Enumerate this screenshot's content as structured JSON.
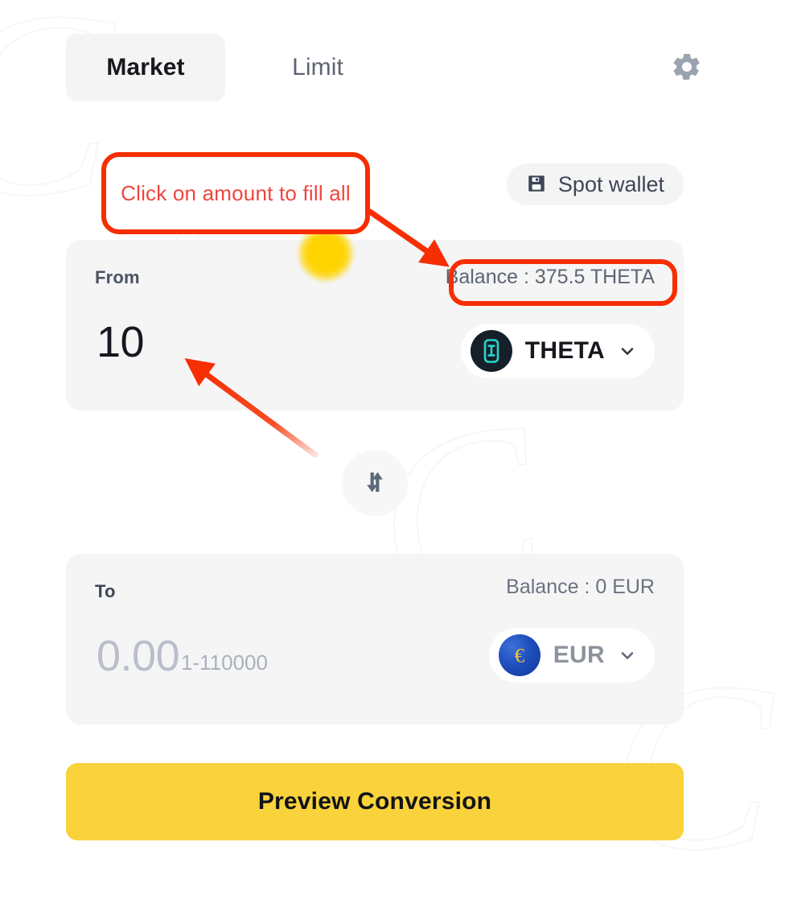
{
  "tabs": [
    {
      "label": "Market",
      "active": true
    },
    {
      "label": "Limit",
      "active": false
    }
  ],
  "header": {
    "settings_icon": "gear-icon"
  },
  "wallet_selector": {
    "label": "Spot wallet",
    "icon": "wallet-icon"
  },
  "from": {
    "label": "From",
    "balance": "Balance : 375.5 THETA",
    "amount": "10",
    "asset": "THETA",
    "asset_icon": "theta-token-icon",
    "chevron": "chevron-down-icon"
  },
  "swap": {
    "icon": "swap-vertical-arrows-icon"
  },
  "to": {
    "label": "To",
    "balance": "Balance : 0 EUR",
    "amount": "0.00",
    "hint": "1-110000",
    "asset": "EUR",
    "asset_icon": "euro-coin-icon",
    "chevron": "chevron-down-icon"
  },
  "cta": {
    "label": "Preview Conversion"
  },
  "annotations": {
    "callout_text": "Click on amount to fill all",
    "highlight_color": "#f62e00",
    "callout_text_color": "#f1453d",
    "glow_color": "#ffd400"
  },
  "colors": {
    "accent_yellow": "#f9d23c",
    "card_background": "#f5f5f6",
    "active_tab_background": "#f4f4f5",
    "text_dark": "#16181d",
    "text_muted": "#5d6673",
    "theta_teal": "#2cd4c8"
  },
  "watermark": {
    "glyphs": [
      "C",
      "C",
      "C",
      "C"
    ]
  }
}
